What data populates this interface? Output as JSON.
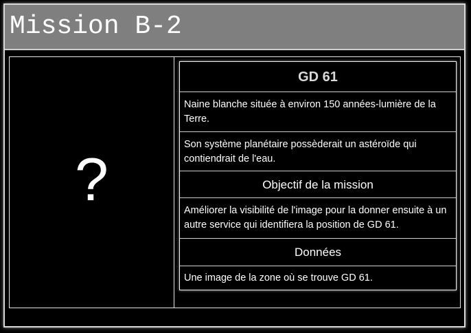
{
  "window": {
    "title": "Mission B-2"
  },
  "image_pane": {
    "placeholder": "?"
  },
  "info": {
    "object_name": "GD 61",
    "description_1": "Naine blanche située à environ 150 années-lumière de la Terre.",
    "description_2": "Son système planétaire possèderait un astéroïde qui contiendrait de l'eau.",
    "objective_heading": "Objectif de la mission",
    "objective_text": "Améliorer la visibilité de l'image pour la donner ensuite à un autre service qui identifiera la position de GD 61.",
    "data_heading": "Données",
    "data_text": "Une image de la zone où se trouve GD 61."
  },
  "colors": {
    "title_bar": "#7f7f7f",
    "background": "#000000",
    "text": "#ffffff",
    "object_name_text": "#d9d9d9",
    "border": "#e6e6e6"
  }
}
